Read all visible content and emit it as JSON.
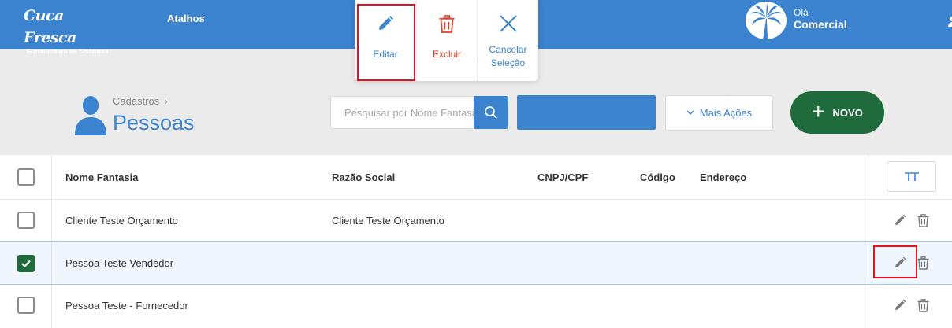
{
  "app": {
    "logo_text": "Cuca Fresca",
    "logo_subtitle": "Fornecedora de Sistemas",
    "nav_atalhos": "Atalhos",
    "greeting": "Olá",
    "user_name": "Comercial",
    "brand_color": "#3b82cf"
  },
  "popup": {
    "edit_label": "Editar",
    "delete_label": "Excluir",
    "cancel_label_line1": "Cancelar",
    "cancel_label_line2": "Seleção"
  },
  "header": {
    "breadcrumb": "Cadastros",
    "breadcrumb_sep": "›",
    "title": "Pessoas",
    "search_placeholder": "Pesquisar por Nome Fantasia",
    "more_actions_label": "Mais Ações",
    "new_label": "NOVO"
  },
  "table": {
    "columns": [
      "Nome Fantasia",
      "Razão Social",
      "CNPJ/CPF",
      "Código",
      "Endereço"
    ],
    "rows": [
      {
        "nome_fantasia": "Cliente Teste Orçamento",
        "razao_social": "Cliente Teste Orçamento",
        "cnpj_cpf": "",
        "codigo": "",
        "endereco": "",
        "checked": false
      },
      {
        "nome_fantasia": "Pessoa Teste Vendedor",
        "razao_social": "",
        "cnpj_cpf": "",
        "codigo": "",
        "endereco": "",
        "checked": true
      },
      {
        "nome_fantasia": "Pessoa Teste - Fornecedor",
        "razao_social": "",
        "cnpj_cpf": "",
        "codigo": "",
        "endereco": "",
        "checked": false
      }
    ]
  }
}
